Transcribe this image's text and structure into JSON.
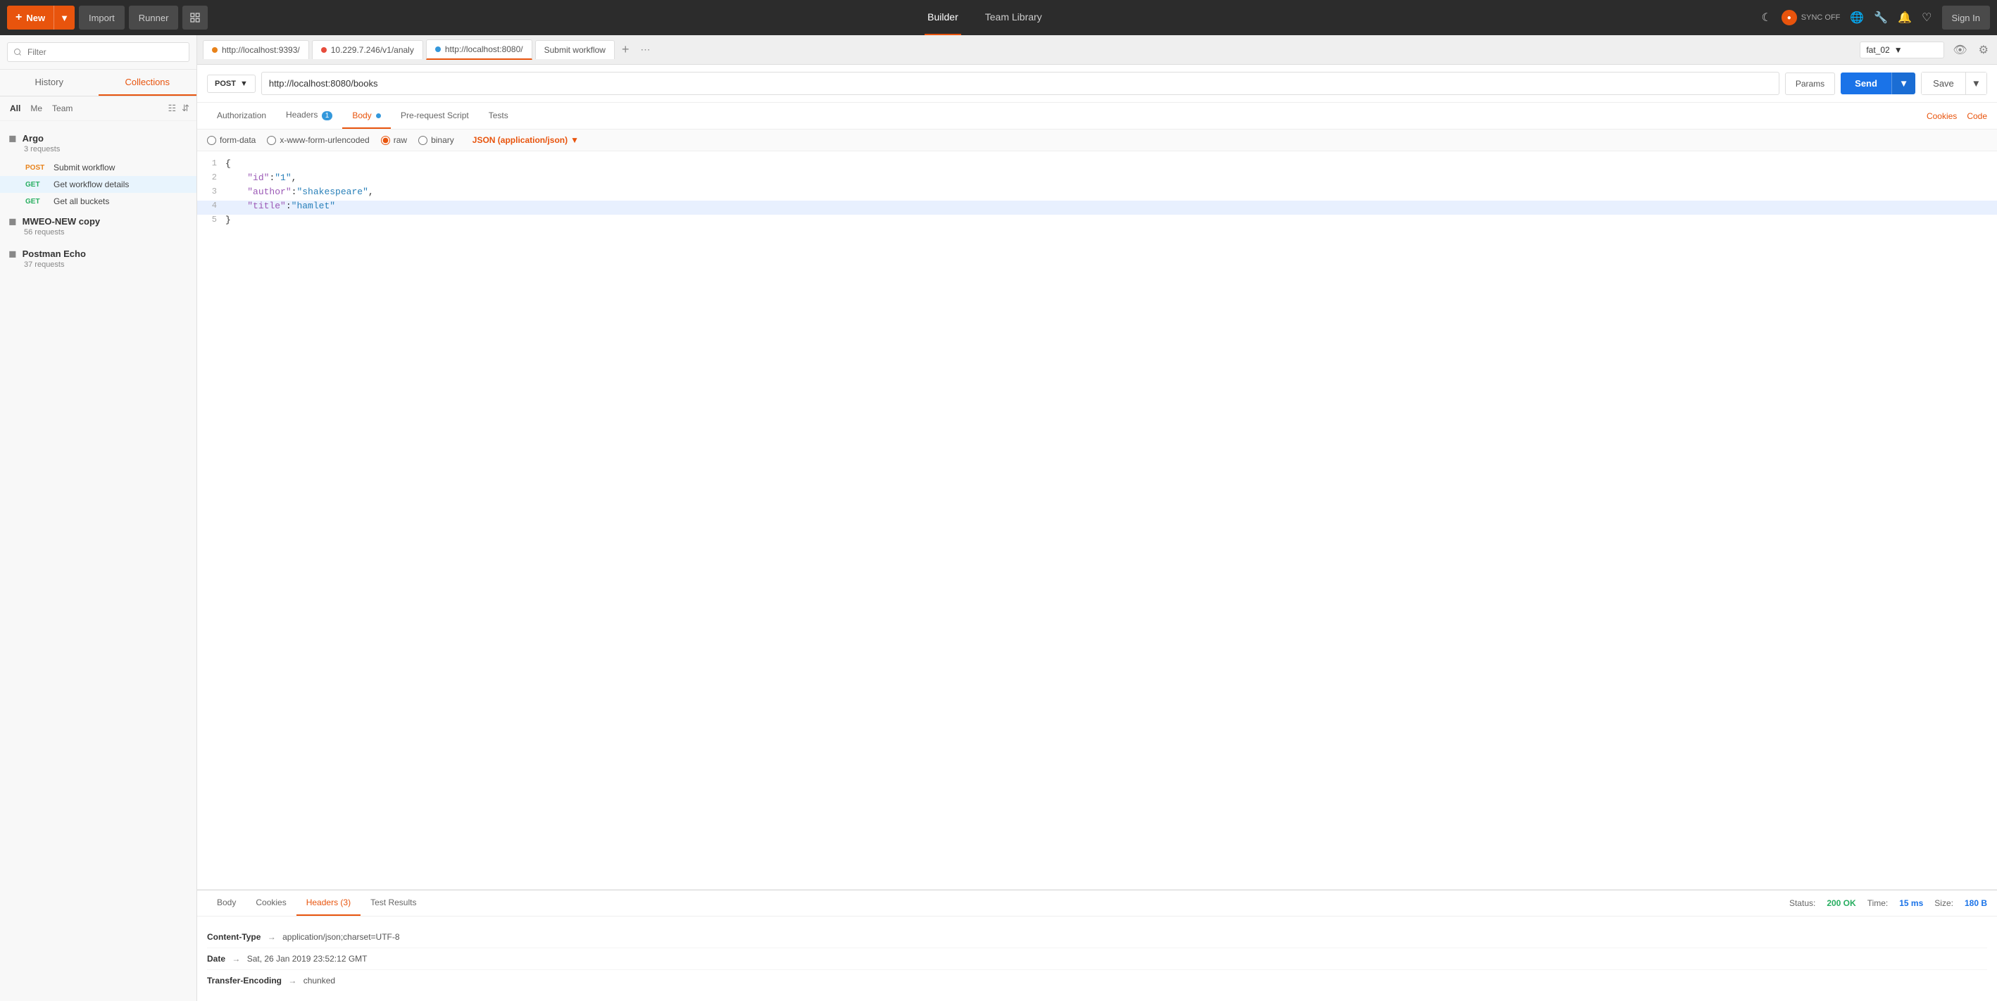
{
  "navbar": {
    "new_label": "New",
    "import_label": "Import",
    "runner_label": "Runner",
    "builder_tab": "Builder",
    "team_library_tab": "Team Library",
    "sync_label": "SYNC OFF",
    "signin_label": "Sign In"
  },
  "sidebar": {
    "filter_placeholder": "Filter",
    "history_tab": "History",
    "collections_tab": "Collections",
    "filter_all": "All",
    "filter_me": "Me",
    "filter_team": "Team",
    "collections": [
      {
        "name": "Argo",
        "count": "3 requests",
        "requests": [
          {
            "method": "POST",
            "name": "Submit workflow"
          },
          {
            "method": "GET",
            "name": "Get workflow details"
          },
          {
            "method": "GET",
            "name": "Get all buckets"
          }
        ]
      },
      {
        "name": "MWEO-NEW copy",
        "count": "56 requests",
        "requests": []
      },
      {
        "name": "Postman Echo",
        "count": "37 requests",
        "requests": []
      }
    ]
  },
  "tabs": [
    {
      "label": "http://localhost:9393/",
      "dot": "orange"
    },
    {
      "label": "10.229.7.246/v1/analy",
      "dot": "red"
    },
    {
      "label": "http://localhost:8080/",
      "dot": "blue"
    },
    {
      "label": "Submit workflow",
      "dot": "none"
    }
  ],
  "env": {
    "selected": "fat_02"
  },
  "request": {
    "method": "POST",
    "url": "http://localhost:8080/books",
    "params_label": "Params",
    "send_label": "Send",
    "save_label": "Save"
  },
  "req_tabs": {
    "authorization": "Authorization",
    "headers": "Headers",
    "headers_count": "1",
    "body": "Body",
    "pre_request": "Pre-request Script",
    "tests": "Tests",
    "cookies": "Cookies",
    "code": "Code"
  },
  "body_types": [
    {
      "id": "form-data",
      "label": "form-data"
    },
    {
      "id": "urlencoded",
      "label": "x-www-form-urlencoded"
    },
    {
      "id": "raw",
      "label": "raw",
      "selected": true
    },
    {
      "id": "binary",
      "label": "binary"
    }
  ],
  "json_type": "JSON (application/json)",
  "code_lines": [
    {
      "num": 1,
      "content": "{",
      "highlighted": false
    },
    {
      "num": 2,
      "content": "    \"id\":\"1\",",
      "highlighted": false
    },
    {
      "num": 3,
      "content": "    \"author\":\"shakespeare\",",
      "highlighted": false
    },
    {
      "num": 4,
      "content": "    \"title\":\"hamlet\"",
      "highlighted": true
    },
    {
      "num": 5,
      "content": "}",
      "highlighted": false
    }
  ],
  "response": {
    "body_tab": "Body",
    "cookies_tab": "Cookies",
    "headers_tab": "Headers",
    "headers_count": "3",
    "test_results_tab": "Test Results",
    "status_label": "Status:",
    "status_value": "200 OK",
    "time_label": "Time:",
    "time_value": "15 ms",
    "size_label": "Size:",
    "size_value": "180 B",
    "headers": [
      {
        "key": "Content-Type",
        "arrow": "→",
        "value": "application/json;charset=UTF-8"
      },
      {
        "key": "Date",
        "arrow": "→",
        "value": "Sat, 26 Jan 2019 23:52:12 GMT"
      },
      {
        "key": "Transfer-Encoding",
        "arrow": "→",
        "value": "chunked"
      }
    ]
  }
}
